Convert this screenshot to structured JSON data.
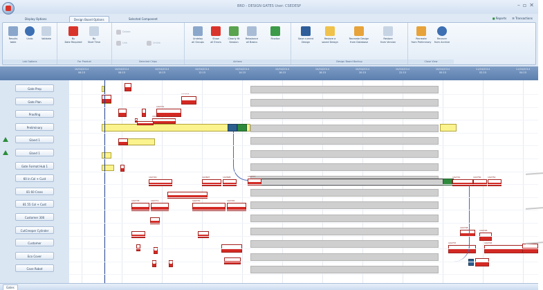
{
  "window": {
    "title": "BRD - DESIGN GATES  User: CSEDESP",
    "controls": [
      "–",
      "▫",
      "✕"
    ]
  },
  "tabs": [
    {
      "label": "Display Options",
      "active": false
    },
    {
      "label": "Design Board Options",
      "active": true
    },
    {
      "label": "Selected Component",
      "active": false
    }
  ],
  "top_links": [
    {
      "label": "Reports"
    },
    {
      "label": "Transactions"
    }
  ],
  "ribbon": {
    "groups": [
      {
        "label": "Lab Options"
      },
      {
        "label": "For Product"
      },
      {
        "label": "Selected Chips"
      },
      {
        "label": "Actions"
      },
      {
        "label": "Design Board Backup"
      },
      {
        "label": "Close View"
      }
    ],
    "buttons": [
      {
        "label": "Results\ntable",
        "icon": "table-icon"
      },
      {
        "label": "Undo",
        "icon": "undo-icon"
      },
      {
        "label": "Validate",
        "icon": "validate-icon"
      },
      {
        "label": "By\nDate Required",
        "icon": "calendar-icon"
      },
      {
        "label": "By\nStart Time",
        "icon": "clock-icon"
      },
      {
        "label": "Delete",
        "icon": "delete-icon"
      },
      {
        "label": "Link",
        "icon": "link-icon"
      },
      {
        "label": "Unlink",
        "icon": "unlink-icon"
      },
      {
        "label": "Undelay\nall Groups",
        "icon": "undelay-icon"
      },
      {
        "label": "Show\nall Errors",
        "icon": "errors-icon"
      },
      {
        "label": "Clearly fit\nSession",
        "icon": "fit-icon"
      },
      {
        "label": "Rebalance\nall Basics",
        "icon": "rebalance-icon"
      },
      {
        "label": "Finalise",
        "icon": "finalise-icon"
      },
      {
        "label": "Save current\nDesign",
        "icon": "save-icon"
      },
      {
        "label": "Restore a\nsaved Design",
        "icon": "folder-icon"
      },
      {
        "label": "Recreate Design\nfrom Database",
        "icon": "database-icon"
      },
      {
        "label": "Restore\nfrom Version",
        "icon": "version-icon"
      },
      {
        "label": "Recreate\nfrom Preliminary",
        "icon": "recreate-icon"
      },
      {
        "label": "Recover\nfrom Archive",
        "icon": "refresh-icon"
      }
    ]
  },
  "timeline": {
    "ticks": [
      {
        "line1": "10/04/2014",
        "line2": "06:15"
      },
      {
        "line1": "10/04/2014",
        "line2": "08:15"
      },
      {
        "line1": "10/04/2014",
        "line2": "10:15"
      },
      {
        "line1": "10/04/2014",
        "line2": "12:15"
      },
      {
        "line1": "10/04/2014",
        "line2": "14:15"
      },
      {
        "line1": "10/04/2014",
        "line2": "16:15"
      },
      {
        "line1": "10/04/2014",
        "line2": "18:15"
      },
      {
        "line1": "10/04/2014",
        "line2": "20:15"
      },
      {
        "line1": "10/04/2014",
        "line2": "22:15"
      },
      {
        "line1": "10/04/2014",
        "line2": "00:15"
      },
      {
        "line1": "11/04/2014",
        "line2": "02:15"
      },
      {
        "line1": "11/04/2014",
        "line2": "04:15"
      }
    ]
  },
  "rows": [
    {
      "label": "Gate Prep",
      "icon": null
    },
    {
      "label": "Gate Plan",
      "icon": null
    },
    {
      "label": "Proofing",
      "icon": null
    },
    {
      "label": "Preliminary",
      "icon": null
    },
    {
      "label": "Gland 1",
      "icon": "warning-triangle-icon"
    },
    {
      "label": "Gland 1",
      "icon": "warning-triangle-icon"
    },
    {
      "label": "Gate Format Hub 1",
      "icon": null
    },
    {
      "label": "60 in Col + Cust",
      "icon": null
    },
    {
      "label": "81 60 Cross",
      "icon": null
    },
    {
      "label": "81 55 Col + Cust",
      "icon": null
    },
    {
      "label": "Customer 300",
      "icon": null
    },
    {
      "label": "CutCreeper Cylinder",
      "icon": null
    },
    {
      "label": "Customer",
      "icon": null
    },
    {
      "label": "Eco Cover",
      "icon": null
    },
    {
      "label": "Cave Robot",
      "icon": null
    }
  ],
  "task_labels": [
    "102741",
    "102773",
    "102778",
    "102724",
    "102697",
    "102698",
    "102777",
    "102778",
    "102771",
    "102770",
    "102740",
    "102741",
    "102750",
    "102752",
    "102738",
    "102726",
    "102757",
    "102745"
  ],
  "status": {
    "tab": "Gates"
  },
  "colors": {
    "task_red": "#d42a24",
    "window_bg": "#dfe9f5",
    "header_blue": "#5b7fae",
    "working_yellow": "#fbf38d",
    "idle_grey": "#cfcfcf"
  }
}
